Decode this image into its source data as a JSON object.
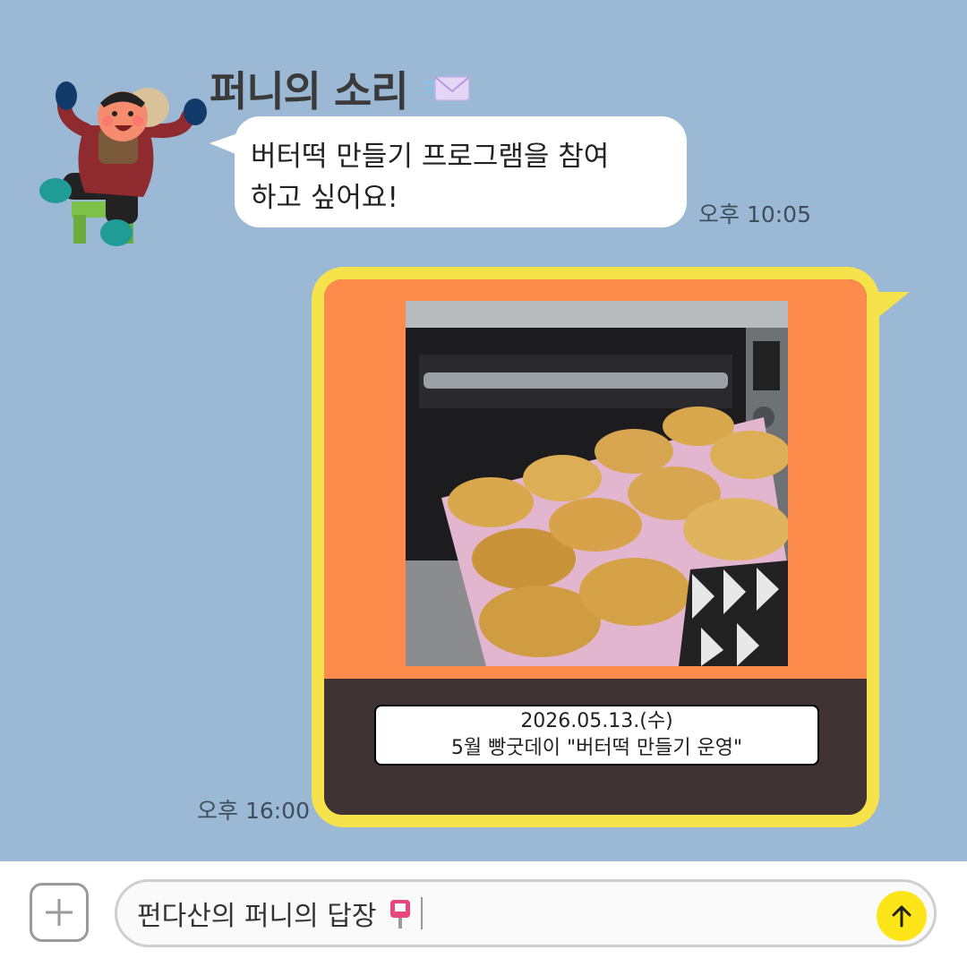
{
  "chat": {
    "sender_name": "퍼니의 소리",
    "incoming": {
      "line1": "버터떡 만들기 프로그램을 참여",
      "line2": "하고 싶어요!",
      "time": "오후 10:05"
    },
    "outgoing": {
      "caption_line1": "2026.05.13.(수)",
      "caption_line2": "5월 빵굿데이 \"버터떡 만들기 운영\"",
      "time": "오후 16:00"
    }
  },
  "input_bar": {
    "text": "펀다산의 퍼니의 답장",
    "icons": {
      "add": "plus-icon",
      "emoji": "mailbox-icon",
      "send": "arrow-up-icon"
    }
  },
  "colors": {
    "background": "#9bb9d5",
    "outgoing_bubble": "#f6e24a",
    "card_orange": "#fd8b4b",
    "card_dark": "#3e3332",
    "send_button": "#fde51a"
  }
}
